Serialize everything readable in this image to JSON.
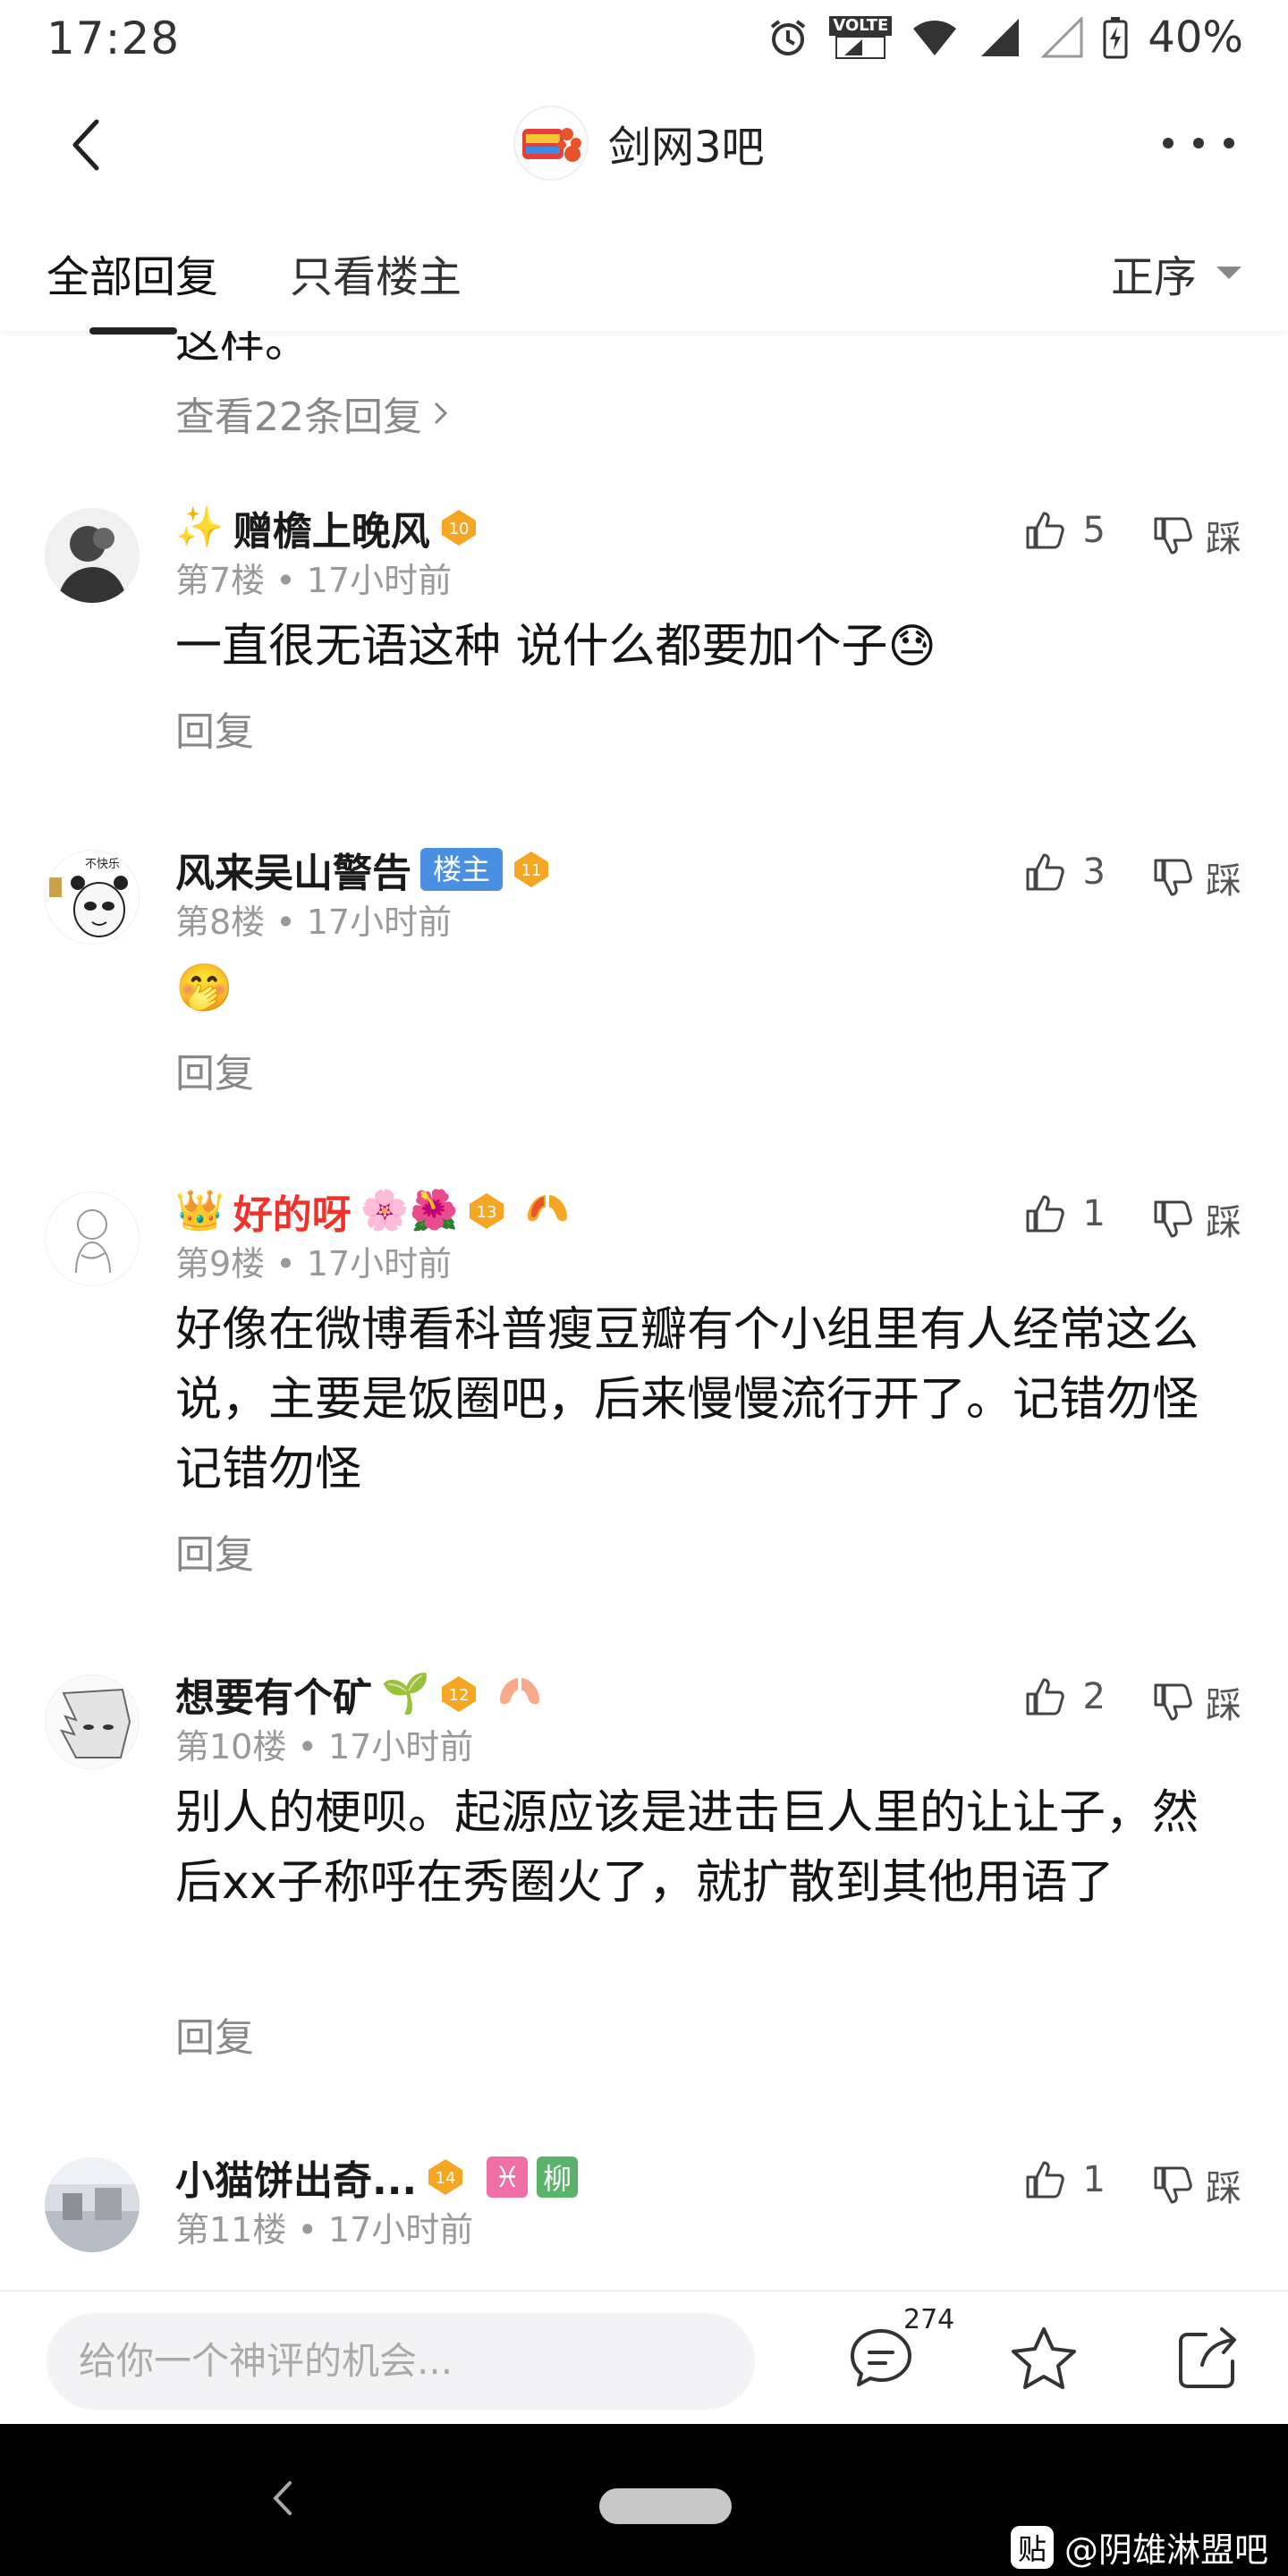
{
  "status_bar": {
    "time": "17:28",
    "volte": "VOLTE",
    "battery": "40%",
    "icons": [
      "alarm-icon",
      "volte-icon",
      "wifi-icon",
      "signal-icon",
      "signal-empty-icon",
      "battery-charging-icon"
    ]
  },
  "header": {
    "forum_name": "剑网3吧",
    "back_icon": "chevron-left-icon",
    "more_icon": "more-dots-icon"
  },
  "tabs": {
    "all_replies": "全部回复",
    "op_only": "只看楼主",
    "sort_label": "正序"
  },
  "prev_thread": {
    "cut_text": "这样。",
    "view_replies": "查看22条回复"
  },
  "posts": [
    {
      "username": "赠檐上晚风",
      "prefix_emoji": "✨",
      "level": "10",
      "floor": "第7楼",
      "time": "17小时前",
      "content": "一直很无语这种 说什么都要加个子",
      "content_emoji": "😓",
      "likes": "5",
      "dislike_label": "踩",
      "reply_label": "回复"
    },
    {
      "username": "风来吴山警告",
      "op_badge": "楼主",
      "level": "11",
      "avatar_text": "不快乐",
      "floor": "第8楼",
      "time": "17小时前",
      "content_emoji": "🤭",
      "likes": "3",
      "dislike_label": "踩",
      "reply_label": "回复"
    },
    {
      "username": "好的呀",
      "prefix_emoji": "👑",
      "suffix_emojis": "🌸🌺",
      "level": "13",
      "floor": "第9楼",
      "time": "17小时前",
      "content": "好像在微博看科普瘦豆瓣有个小组里有人经常这么说，主要是饭圈吧，后来慢慢流行开了。记错勿怪记错勿怪",
      "likes": "1",
      "dislike_label": "踩",
      "reply_label": "回复"
    },
    {
      "username": "想要有个矿",
      "suffix_emojis": "🌱",
      "level": "12",
      "floor": "第10楼",
      "time": "17小时前",
      "content": "别人的梗呗。起源应该是进击巨人里的让让子，然后xx子称呼在秀圈火了，就扩散到其他用语了",
      "likes": "2",
      "dislike_label": "踩",
      "reply_label": "回复"
    },
    {
      "username": "小猫饼出奇...",
      "level": "14",
      "tag_pisces": "♓",
      "tag_liu": "柳",
      "floor": "第11楼",
      "time": "17小时前",
      "likes": "1",
      "dislike_label": "踩"
    }
  ],
  "bottom_bar": {
    "input_placeholder": "给你一个神评的机会...",
    "comment_count": "274",
    "icons": [
      "comment-icon",
      "star-icon",
      "share-icon"
    ]
  },
  "watermark": {
    "logo_text": "贴",
    "text": "@阴雄淋盟吧"
  },
  "colors": {
    "op_badge": "#4a90e2",
    "level_badge": "#f5a623",
    "red_username": "#f0332a",
    "muted_text": "#999999"
  }
}
